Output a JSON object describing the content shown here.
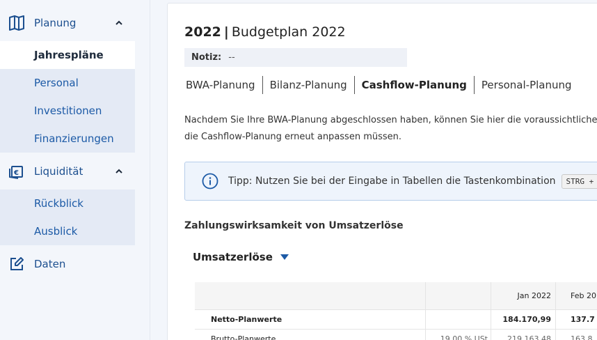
{
  "sidebar": {
    "planung": {
      "label": "Planung",
      "items": [
        "Jahrespläne",
        "Personal",
        "Investitionen",
        "Finanzierungen"
      ]
    },
    "liquiditaet": {
      "label": "Liquidität",
      "items": [
        "Rückblick",
        "Ausblick"
      ]
    },
    "daten": {
      "label": "Daten"
    }
  },
  "header": {
    "year": "2022",
    "separator": "|",
    "title": "Budgetplan 2022"
  },
  "notiz": {
    "label": "Notiz:",
    "value": "--"
  },
  "tabs": [
    "BWA-Planung",
    "Bilanz-Planung",
    "Cashflow-Planung",
    "Personal-Planung"
  ],
  "description": {
    "line1": "Nachdem Sie Ihre BWA-Planung abgeschlossen haben, können Sie hier die voraussichtliche Zah",
    "line2": "die Cashflow-Planung erneut anpassen müssen."
  },
  "tip": {
    "text": "Tipp: Nutzen Sie bei der Eingabe in Tabellen die Tastenkombination",
    "kbd": "STRG + EN"
  },
  "section": {
    "title": "Zahlungswirksamkeit von Umsatzerlöse"
  },
  "dropdown": {
    "label": "Umsatzerlöse"
  },
  "table": {
    "header": [
      "",
      "",
      "Jan 2022",
      "Feb 20"
    ],
    "rows": [
      [
        "Netto-Planwerte",
        "",
        "184.170,99",
        "137.7"
      ],
      [
        "Brutto-Planwerte",
        "19,00 % USt",
        "219.163,48",
        "163.8"
      ]
    ]
  },
  "colors": {
    "accent": "#1c5aa6",
    "active_bg": "#ffffff",
    "sub_bg": "#e4eaf5"
  }
}
